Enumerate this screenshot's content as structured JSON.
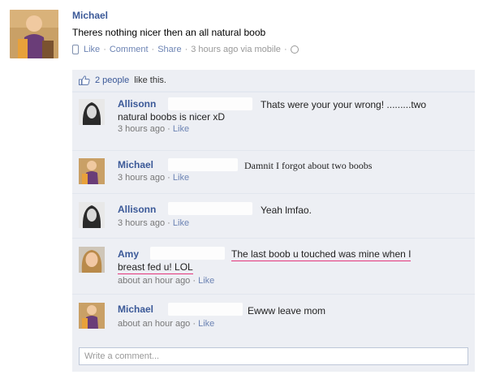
{
  "post": {
    "author": "Michael",
    "status": "Theres nothing nicer then an all natural boob",
    "actions": {
      "like": "Like",
      "comment": "Comment",
      "share": "Share"
    },
    "time": "3 hours ago via mobile",
    "sep": "·"
  },
  "likes": {
    "count_text": "2 people",
    "suffix": "like this."
  },
  "comments": [
    {
      "author": "Allisonn",
      "text1": "Thats were your your wrong! .........two",
      "text2": "natural boobs is nicer xD",
      "time": "3 hours ago",
      "like": "Like"
    },
    {
      "author": "Michael",
      "text1": "Damnit I forgot about two boobs",
      "time": "3 hours ago",
      "like": "Like"
    },
    {
      "author": "Allisonn",
      "text1": "Yeah lmfao.",
      "time": "3 hours ago",
      "like": "Like"
    },
    {
      "author": "Amy",
      "text1": "The last boob u touched was mine when I",
      "text2": "breast fed u! LOL",
      "time": "about an hour ago",
      "like": "Like"
    },
    {
      "author": "Michael",
      "text1": "Ewww leave mom",
      "time": "about an hour ago",
      "like": "Like"
    }
  ],
  "write_comment": {
    "placeholder": "Write a comment..."
  },
  "colors": {
    "link": "#3b5998",
    "panel": "#edeff4",
    "underline": "#e3357a"
  }
}
